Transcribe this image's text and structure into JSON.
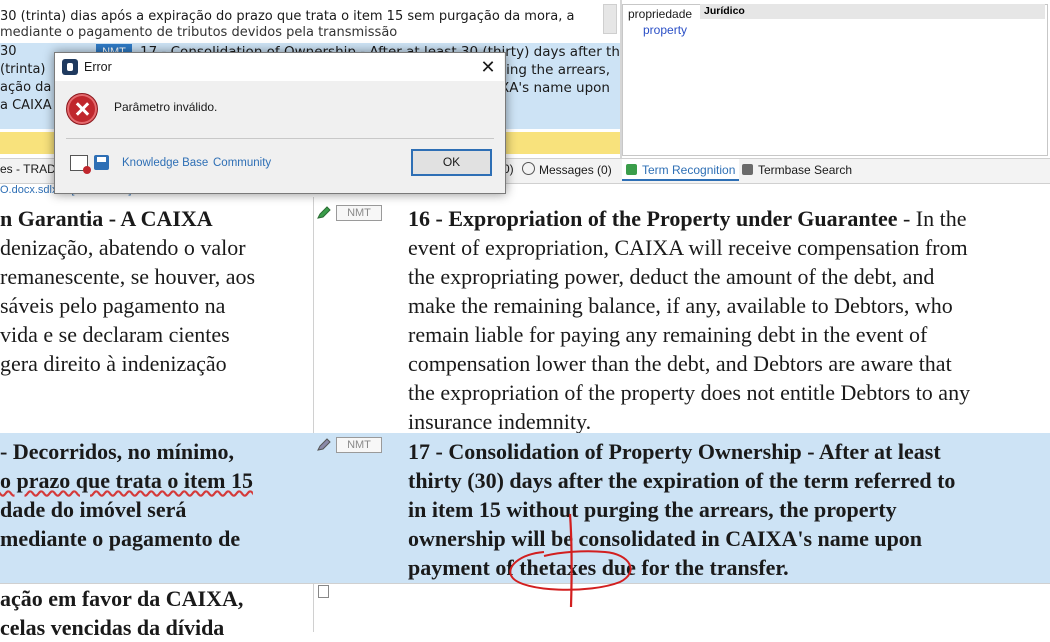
{
  "top_panel": {
    "line1": "30 (trinta) dias após a expiração do prazo que trata o item 15 sem purgação da mora, a",
    "line2": "mediante o pagamento de tributos devidos pela transmissão",
    "row_left": [
      "30 (trinta)",
      "ação da",
      "a CAIXA"
    ],
    "nmt": "NMT",
    "row_right": [
      "17 - Consolidation of Ownership - After at least 30 (thirty) days after the",
      "ging the arrears,",
      "XA's name upon"
    ]
  },
  "right_panel": {
    "source_term": "propriedade",
    "tag": "Jurídico",
    "target_term": "property"
  },
  "tabs": {
    "project": "es - TRADO",
    "partial": "0)",
    "messages": "Messages (0)",
    "term_recognition": "Term Recognition",
    "termbase_search": "Termbase Search"
  },
  "file_path": "O.docx.sdlxliff [Translation]",
  "segments": {
    "seg1": {
      "nmt": "NMT",
      "source": [
        "n Garantia - A CAIXA",
        "denização, abatendo o valor",
        " remanescente, se houver, aos",
        "sáveis pelo pagamento na",
        "vida e se declaram cientes",
        " gera direito à indenização"
      ],
      "target_title": "16 - Expropriation of the Property under Guarantee",
      "target": [
        " - In the",
        "event of expropriation, CAIXA will receive compensation from",
        "the expropriating power, deduct the amount of the debt, and",
        "make the remaining balance, if any, available to Debtors, who",
        "remain liable for paying any remaining debt in the event of",
        "compensation lower than the debt, and Debtors are aware that",
        "the expropriation of the property does not entitle Debtors to any",
        "insurance indemnity."
      ]
    },
    "seg2": {
      "nmt": "NMT",
      "source": [
        " - Decorridos, no mínimo,",
        "o prazo que trata o item 15",
        "dade do imóvel será",
        "mediante o pagamento de"
      ],
      "target": [
        "17 - Consolidation of Property Ownership - After at least",
        "thirty (30) days after the expiration of the term referred to",
        "in item 15 without purging the arrears, the property",
        "ownership will be consolidated in CAIXA's name upon",
        "payment of thetaxes due for the transfer."
      ]
    },
    "seg3": {
      "source": [
        "ação em favor da CAIXA,",
        "celas vencidas da dívida"
      ]
    }
  },
  "dialog": {
    "title": "Error",
    "close": "✕",
    "message": "Parâmetro inválido.",
    "knowledge_base": "Knowledge Base",
    "community": "Community",
    "ok": "OK"
  }
}
